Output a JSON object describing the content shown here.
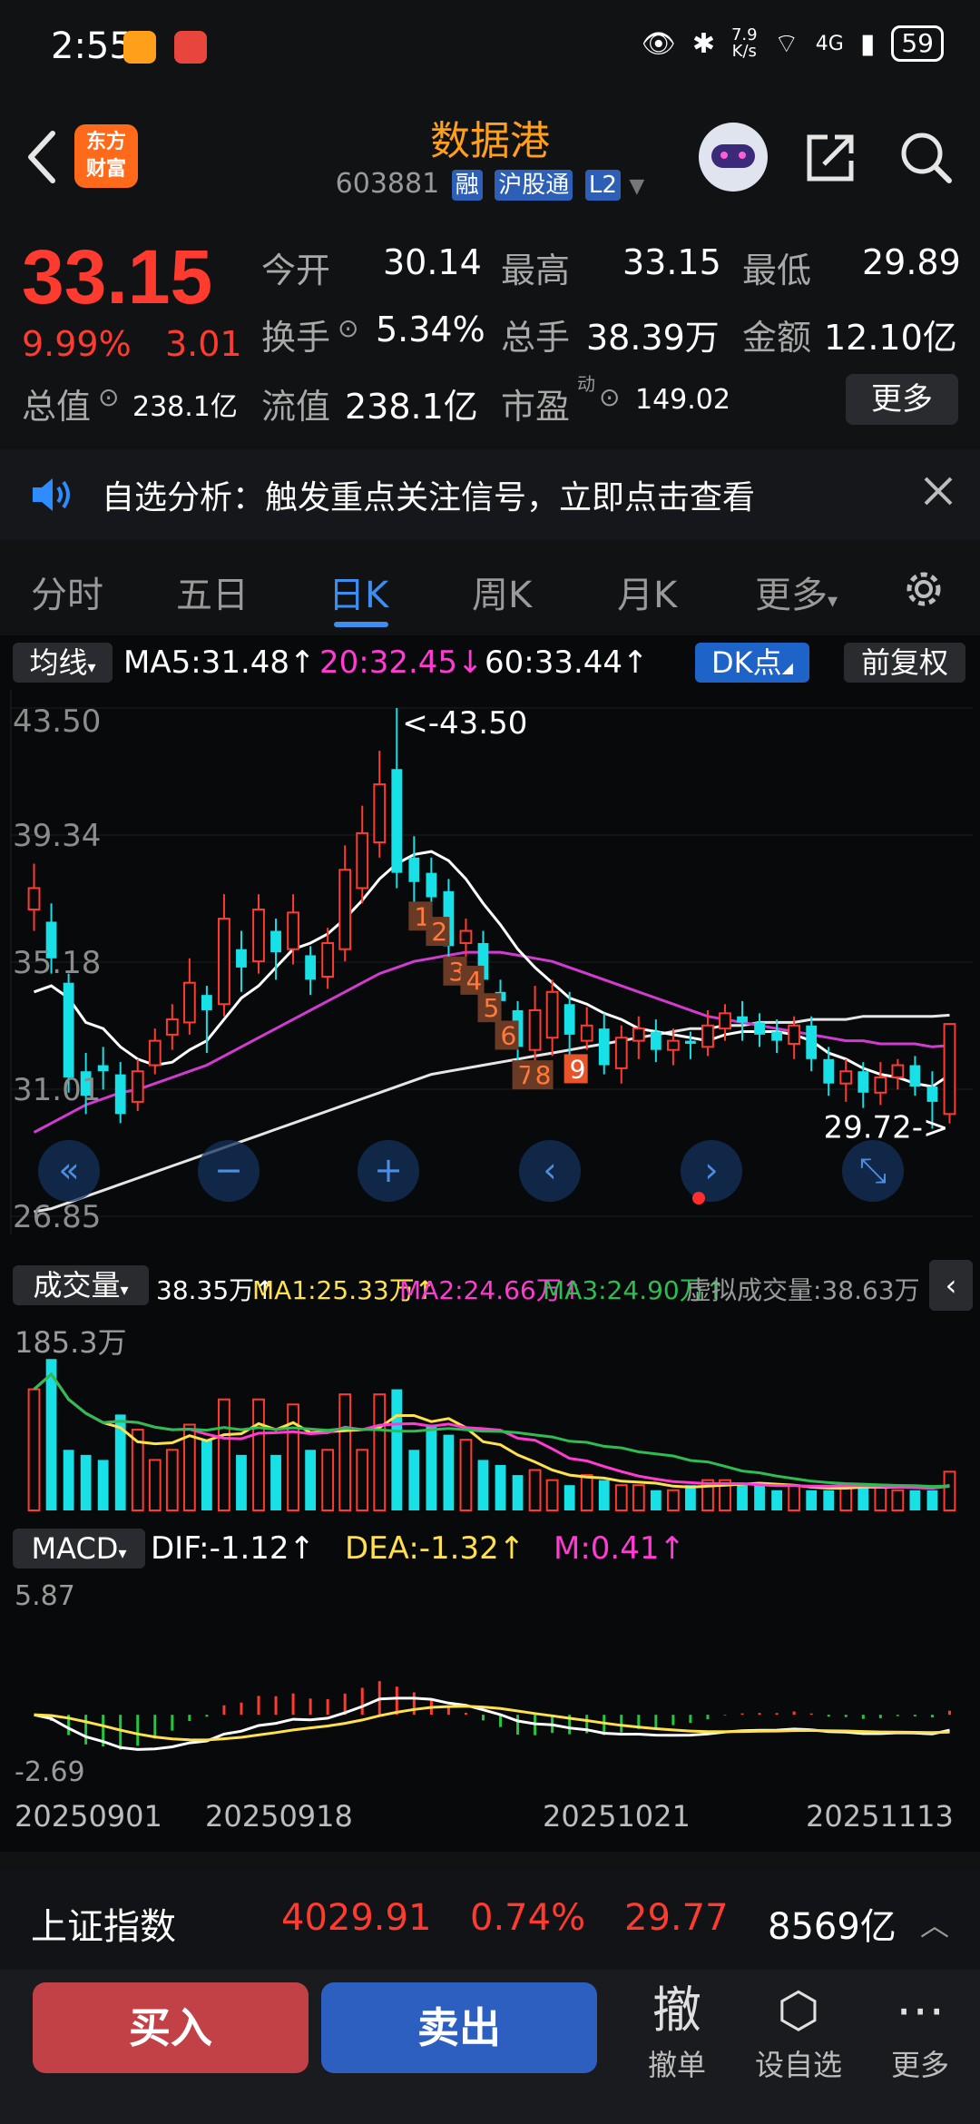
{
  "status_bar": {
    "time": "2:55",
    "net_speed_top": "7.9",
    "net_speed_bottom": "K/s",
    "network": "4G",
    "battery": "59"
  },
  "header": {
    "title": "数据港",
    "code": "603881",
    "tags": [
      "融",
      "沪股通",
      "L2"
    ],
    "logo_line1": "东方",
    "logo_line2": "财富"
  },
  "quote": {
    "price": "33.15",
    "change_pct": "9.99%",
    "change": "3.01",
    "open_label": "今开",
    "open": "30.14",
    "high_label": "最高",
    "high": "33.15",
    "low_label": "最低",
    "low": "29.89",
    "turnover_label": "换手",
    "turnover": "5.34%",
    "volume_label": "总手",
    "volume": "38.39万",
    "amount_label": "金额",
    "amount": "12.10亿",
    "mktcap_label": "总值",
    "mktcap": "238.1亿",
    "float_label": "流值",
    "float": "238.1亿",
    "pe_label": "市盈",
    "pe_sup": "动",
    "pe": "149.02",
    "more": "更多"
  },
  "notice": {
    "text": "自选分析：触发重点关注信号，立即点击查看"
  },
  "tabs": [
    "分时",
    "五日",
    "日K",
    "周K",
    "月K",
    "更多"
  ],
  "active_tab": 2,
  "indicators": {
    "ma_label": "均线",
    "ma5": "MA5:31.48↑",
    "ma20": "20:32.45↓",
    "ma60": "60:33.44↑",
    "dk_label": "DK点",
    "adjust_label": "前复权"
  },
  "volume_panel": {
    "label": "成交量",
    "vol": "38.35万↑",
    "ma1": "MA1:25.33万↑",
    "ma2": "MA2:24.66万↑",
    "ma3": "MA3:24.90万↑",
    "virtual": "虚拟成交量:38.63万",
    "axis_max": "185.3万"
  },
  "macd_panel": {
    "label": "MACD",
    "dif": "DIF:-1.12↑",
    "dea": "DEA:-1.32↑",
    "m": "M:0.41↑",
    "axis_max": "5.87",
    "axis_min": "-2.69"
  },
  "chart_data": {
    "type": "candlestick",
    "y_ticks": [
      "43.50",
      "39.34",
      "35.18",
      "31.01",
      "26.85"
    ],
    "ylim": [
      26.85,
      43.5
    ],
    "annotation_high": "<-43.50",
    "annotation_low": "29.72->",
    "x_labels": [
      "20250901",
      "20250918",
      "20251021",
      "20251113"
    ],
    "candles": [
      {
        "o": 36.9,
        "c": 37.6,
        "h": 38.4,
        "l": 36.2
      },
      {
        "o": 36.5,
        "c": 35.3,
        "h": 37.1,
        "l": 34.8
      },
      {
        "o": 34.5,
        "c": 31.4,
        "h": 34.8,
        "l": 30.9
      },
      {
        "o": 31.6,
        "c": 30.8,
        "h": 32.2,
        "l": 30.2
      },
      {
        "o": 31.8,
        "c": 31.6,
        "h": 32.4,
        "l": 31.0
      },
      {
        "o": 31.5,
        "c": 30.2,
        "h": 31.9,
        "l": 29.9
      },
      {
        "o": 30.6,
        "c": 31.6,
        "h": 32.0,
        "l": 30.3
      },
      {
        "o": 31.8,
        "c": 32.6,
        "h": 33.0,
        "l": 31.5
      },
      {
        "o": 32.8,
        "c": 33.3,
        "h": 33.8,
        "l": 32.3
      },
      {
        "o": 33.2,
        "c": 34.5,
        "h": 35.3,
        "l": 32.8
      },
      {
        "o": 34.1,
        "c": 33.6,
        "h": 34.4,
        "l": 32.2
      },
      {
        "o": 33.8,
        "c": 36.6,
        "h": 37.4,
        "l": 33.4
      },
      {
        "o": 35.6,
        "c": 35.0,
        "h": 36.2,
        "l": 34.2
      },
      {
        "o": 35.2,
        "c": 36.9,
        "h": 37.4,
        "l": 34.8
      },
      {
        "o": 36.2,
        "c": 35.5,
        "h": 36.6,
        "l": 34.6
      },
      {
        "o": 35.6,
        "c": 36.8,
        "h": 37.4,
        "l": 35.1
      },
      {
        "o": 35.4,
        "c": 34.6,
        "h": 35.7,
        "l": 34.1
      },
      {
        "o": 34.7,
        "c": 35.8,
        "h": 36.3,
        "l": 34.3
      },
      {
        "o": 35.6,
        "c": 38.2,
        "h": 39.0,
        "l": 35.2
      },
      {
        "o": 37.6,
        "c": 39.4,
        "h": 40.3,
        "l": 37.1
      },
      {
        "o": 39.1,
        "c": 41.0,
        "h": 42.1,
        "l": 38.6
      },
      {
        "o": 41.5,
        "c": 38.1,
        "h": 43.5,
        "l": 37.6
      },
      {
        "o": 38.6,
        "c": 37.8,
        "h": 39.3,
        "l": 37.1
      },
      {
        "o": 38.1,
        "c": 37.3,
        "h": 38.6,
        "l": 36.6
      },
      {
        "o": 37.5,
        "c": 35.7,
        "h": 37.9,
        "l": 35.3
      },
      {
        "o": 35.8,
        "c": 36.2,
        "h": 36.6,
        "l": 35.0
      },
      {
        "o": 35.8,
        "c": 34.6,
        "h": 36.2,
        "l": 34.1
      },
      {
        "o": 34.2,
        "c": 33.9,
        "h": 34.6,
        "l": 33.2
      },
      {
        "o": 33.6,
        "c": 32.4,
        "h": 33.9,
        "l": 31.9
      },
      {
        "o": 32.3,
        "c": 33.6,
        "h": 34.4,
        "l": 31.9
      },
      {
        "o": 32.7,
        "c": 34.2,
        "h": 34.6,
        "l": 32.1
      },
      {
        "o": 33.8,
        "c": 32.8,
        "h": 34.2,
        "l": 32.1
      },
      {
        "o": 32.6,
        "c": 33.1,
        "h": 33.7,
        "l": 32.3
      },
      {
        "o": 33.0,
        "c": 31.8,
        "h": 33.5,
        "l": 31.5
      },
      {
        "o": 31.7,
        "c": 32.7,
        "h": 33.1,
        "l": 31.2
      },
      {
        "o": 32.6,
        "c": 33.0,
        "h": 33.4,
        "l": 32.0
      },
      {
        "o": 32.9,
        "c": 32.3,
        "h": 33.3,
        "l": 31.9
      },
      {
        "o": 32.3,
        "c": 32.6,
        "h": 33.0,
        "l": 31.8
      },
      {
        "o": 32.6,
        "c": 32.5,
        "h": 32.9,
        "l": 32.0
      },
      {
        "o": 32.4,
        "c": 33.1,
        "h": 33.6,
        "l": 32.1
      },
      {
        "o": 33.0,
        "c": 33.5,
        "h": 33.8,
        "l": 32.6
      },
      {
        "o": 33.4,
        "c": 33.2,
        "h": 33.9,
        "l": 32.6
      },
      {
        "o": 33.2,
        "c": 32.8,
        "h": 33.5,
        "l": 32.4
      },
      {
        "o": 32.9,
        "c": 32.6,
        "h": 33.3,
        "l": 32.2
      },
      {
        "o": 32.5,
        "c": 33.1,
        "h": 33.4,
        "l": 32.0
      },
      {
        "o": 33.1,
        "c": 32.0,
        "h": 33.4,
        "l": 31.6
      },
      {
        "o": 32.0,
        "c": 31.2,
        "h": 32.4,
        "l": 30.8
      },
      {
        "o": 31.2,
        "c": 31.6,
        "h": 32.0,
        "l": 30.6
      },
      {
        "o": 31.6,
        "c": 30.9,
        "h": 31.9,
        "l": 30.4
      },
      {
        "o": 30.9,
        "c": 31.4,
        "h": 31.9,
        "l": 30.5
      },
      {
        "o": 31.4,
        "c": 31.8,
        "h": 32.0,
        "l": 31.0
      },
      {
        "o": 31.8,
        "c": 31.1,
        "h": 32.1,
        "l": 30.8
      },
      {
        "o": 31.1,
        "c": 30.6,
        "h": 31.6,
        "l": 29.72
      },
      {
        "o": 30.2,
        "c": 33.15,
        "h": 33.15,
        "l": 29.89
      }
    ],
    "ma5": [
      34.2,
      34.4,
      34.0,
      33.2,
      33.0,
      32.4,
      32.0,
      31.8,
      31.9,
      32.3,
      32.6,
      33.3,
      34.0,
      34.4,
      35.0,
      35.6,
      35.8,
      36.1,
      36.6,
      37.2,
      37.9,
      38.4,
      38.7,
      38.8,
      38.5,
      37.9,
      37.1,
      36.4,
      35.6,
      35.0,
      34.5,
      34.0,
      33.8,
      33.5,
      33.3,
      33.0,
      32.9,
      32.8,
      32.7,
      32.6,
      32.8,
      32.9,
      32.9,
      32.9,
      32.8,
      32.6,
      32.2,
      32.0,
      31.7,
      31.5,
      31.4,
      31.2,
      31.1,
      31.48
    ],
    "ma20": [
      29.6,
      29.9,
      30.2,
      30.5,
      30.7,
      30.9,
      31.0,
      31.2,
      31.4,
      31.6,
      31.8,
      32.1,
      32.4,
      32.7,
      33.0,
      33.3,
      33.6,
      33.9,
      34.2,
      34.5,
      34.8,
      35.0,
      35.2,
      35.3,
      35.4,
      35.5,
      35.5,
      35.5,
      35.4,
      35.3,
      35.2,
      35.0,
      34.8,
      34.6,
      34.4,
      34.2,
      34.0,
      33.8,
      33.6,
      33.4,
      33.3,
      33.2,
      33.1,
      33.0,
      32.9,
      32.8,
      32.7,
      32.6,
      32.6,
      32.5,
      32.5,
      32.5,
      32.4,
      32.45
    ],
    "ma60": [
      27.0,
      27.1,
      27.3,
      27.5,
      27.7,
      27.9,
      28.1,
      28.3,
      28.5,
      28.7,
      28.9,
      29.1,
      29.3,
      29.5,
      29.7,
      29.9,
      30.1,
      30.3,
      30.5,
      30.7,
      30.9,
      31.1,
      31.3,
      31.5,
      31.6,
      31.7,
      31.8,
      31.9,
      32.0,
      32.1,
      32.2,
      32.3,
      32.4,
      32.5,
      32.6,
      32.7,
      32.8,
      32.9,
      33.0,
      33.0,
      33.1,
      33.1,
      33.2,
      33.2,
      33.2,
      33.3,
      33.3,
      33.3,
      33.4,
      33.4,
      33.4,
      33.4,
      33.4,
      33.44
    ],
    "signals": [
      {
        "i": 22,
        "t": "1"
      },
      {
        "i": 23,
        "t": "2"
      },
      {
        "i": 24,
        "t": "3"
      },
      {
        "i": 25,
        "t": "4"
      },
      {
        "i": 26,
        "t": "5"
      },
      {
        "i": 27,
        "t": "6"
      },
      {
        "i": 28,
        "t": "7"
      },
      {
        "i": 29,
        "t": "8"
      },
      {
        "i": 31,
        "t": "9"
      }
    ],
    "volume_values": [
      120,
      150,
      60,
      55,
      50,
      95,
      80,
      50,
      60,
      85,
      70,
      110,
      55,
      110,
      55,
      105,
      60,
      60,
      115,
      60,
      115,
      120,
      60,
      85,
      75,
      70,
      50,
      45,
      35,
      40,
      30,
      25,
      35,
      30,
      25,
      25,
      20,
      20,
      25,
      30,
      30,
      25,
      25,
      20,
      25,
      20,
      20,
      25,
      25,
      25,
      20,
      20,
      20,
      38.35
    ]
  },
  "chart_controls": [
    "«",
    "−",
    "+",
    "‹",
    "›",
    "⤡"
  ],
  "index_bar": {
    "name": "上证指数",
    "value": "4029.91",
    "pct": "0.74%",
    "change": "29.77",
    "amount": "8569亿"
  },
  "actions": {
    "buy": "买入",
    "sell": "卖出",
    "cancel_icon": "撤",
    "cancel": "撤单",
    "watch": "设自选",
    "more": "更多"
  }
}
